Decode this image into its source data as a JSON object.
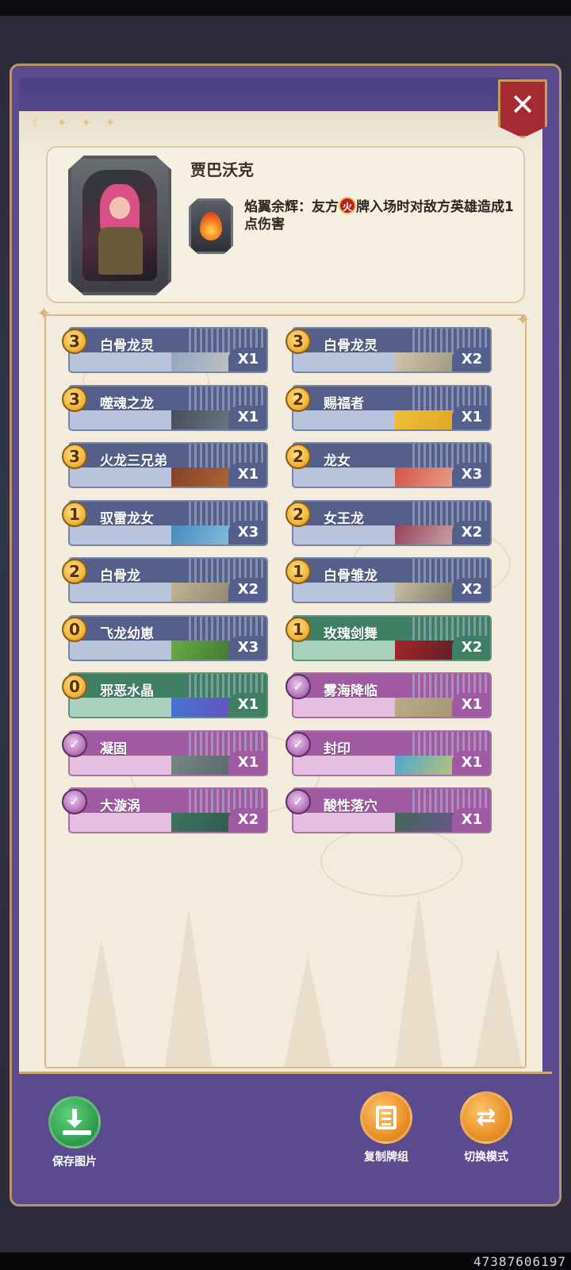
{
  "hero": {
    "name": "贾巴沃克",
    "skill_prefix": "焰翼余辉：友方",
    "skill_badge": "火",
    "skill_suffix": "牌入场时对敌方英雄造成1点伤害"
  },
  "close_label": "✕",
  "cards_left": [
    {
      "cost": "3",
      "name": "白骨龙灵",
      "count": "X1",
      "type": "blue",
      "art": [
        "#8aa0c8",
        "#d6d0b8"
      ]
    },
    {
      "cost": "3",
      "name": "噬魂之龙",
      "count": "X1",
      "type": "blue",
      "art": [
        "#404550",
        "#7c8ca0"
      ]
    },
    {
      "cost": "3",
      "name": "火龙三兄弟",
      "count": "X1",
      "type": "blue",
      "art": [
        "#7a3a24",
        "#c7783a"
      ]
    },
    {
      "cost": "1",
      "name": "驭雷龙女",
      "count": "X3",
      "type": "blue",
      "art": [
        "#3a7fb6",
        "#a7d8f2"
      ]
    },
    {
      "cost": "2",
      "name": "白骨龙",
      "count": "X2",
      "type": "blue",
      "art": [
        "#c9bd9a",
        "#7a7060"
      ]
    },
    {
      "cost": "0",
      "name": "飞龙幼崽",
      "count": "X3",
      "type": "blue",
      "art": [
        "#6fb54a",
        "#2f5e28"
      ]
    },
    {
      "cost": "0",
      "name": "邪恶水晶",
      "count": "X1",
      "type": "green",
      "art": [
        "#3d7fd8",
        "#7a3ab0"
      ]
    },
    {
      "cost": "✓",
      "name": "凝固",
      "count": "X1",
      "type": "pink",
      "art": [
        "#7d8c8a",
        "#4c5a58"
      ]
    },
    {
      "cost": "✓",
      "name": "大漩涡",
      "count": "X2",
      "type": "pink",
      "art": [
        "#3f7a64",
        "#2d4c48"
      ]
    }
  ],
  "cards_right": [
    {
      "cost": "3",
      "name": "白骨龙灵",
      "count": "X2",
      "type": "blue",
      "art": [
        "#d8cfb4",
        "#8a7f68"
      ]
    },
    {
      "cost": "2",
      "name": "赐福者",
      "count": "X1",
      "type": "blue",
      "art": [
        "#f2c43a",
        "#d99a18"
      ]
    },
    {
      "cost": "2",
      "name": "龙女",
      "count": "X3",
      "type": "blue",
      "art": [
        "#d0443a",
        "#f3c9a6"
      ]
    },
    {
      "cost": "2",
      "name": "女王龙",
      "count": "X2",
      "type": "blue",
      "art": [
        "#8a2f4a",
        "#e8d8d0"
      ]
    },
    {
      "cost": "1",
      "name": "白骨雏龙",
      "count": "X2",
      "type": "blue",
      "art": [
        "#d4ccb2",
        "#5a5446"
      ]
    },
    {
      "cost": "1",
      "name": "玫瑰剑舞",
      "count": "X2",
      "type": "green",
      "art": [
        "#b3262c",
        "#3a1c24"
      ]
    },
    {
      "cost": "✓",
      "name": "雾海降临",
      "count": "X1",
      "type": "pink",
      "art": [
        "#c0b08a",
        "#9a8a66"
      ]
    },
    {
      "cost": "✓",
      "name": "封印",
      "count": "X1",
      "type": "pink",
      "art": [
        "#3aa0e0",
        "#f2d24a"
      ]
    },
    {
      "cost": "✓",
      "name": "酸性落穴",
      "count": "X1",
      "type": "pink",
      "art": [
        "#3d6a4c",
        "#7a4fa8"
      ]
    }
  ],
  "footer": {
    "save_label": "保存图片",
    "copy_label": "复制牌组",
    "switch_label": "切换模式"
  },
  "watermark": "47387606197"
}
